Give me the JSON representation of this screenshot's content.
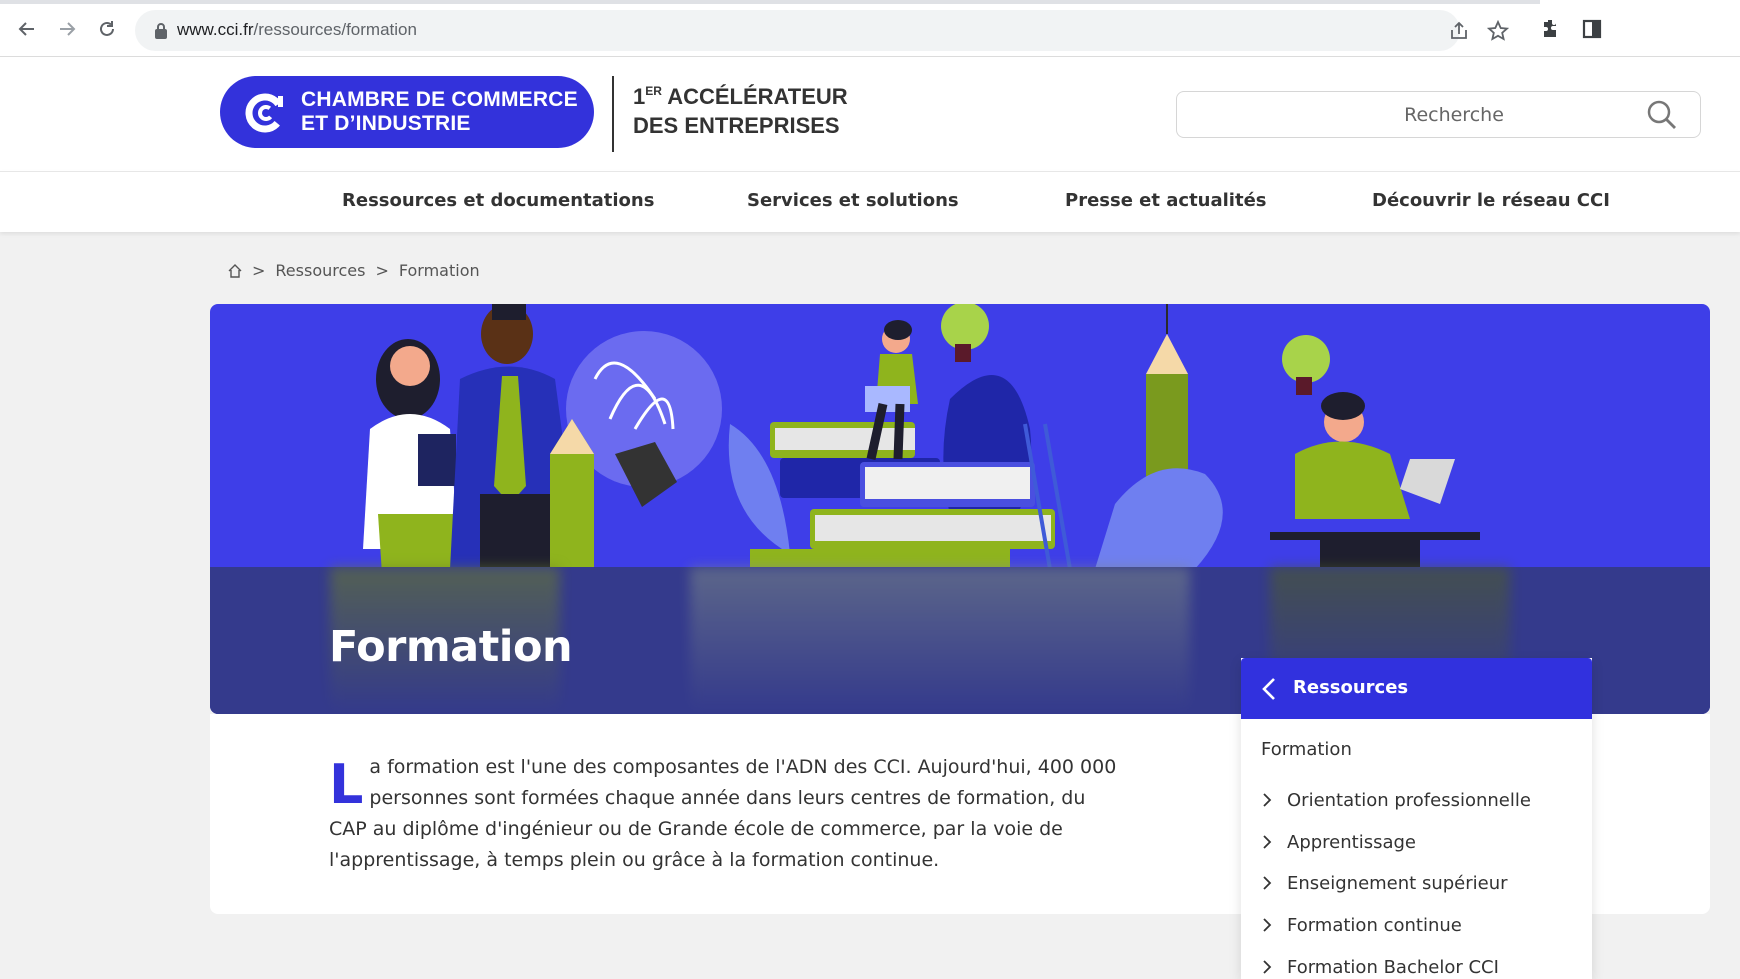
{
  "browser": {
    "url_host": "www.cci.fr",
    "url_path": "/ressources/formation"
  },
  "header": {
    "logo_line1": "CHAMBRE DE COMMERCE",
    "logo_line2": "ET D’INDUSTRIE",
    "tagline_num": "1",
    "tagline_sup": "ER",
    "tagline_line1": " ACCÉLÉRATEUR",
    "tagline_line2": "DES ENTREPRISES",
    "search_placeholder": "Recherche"
  },
  "nav": {
    "items": [
      {
        "label": "Ressources et documentations"
      },
      {
        "label": "Services et solutions"
      },
      {
        "label": "Presse et actualités"
      },
      {
        "label": "Découvrir le réseau CCI"
      }
    ]
  },
  "breadcrumb": {
    "sep": ">",
    "items": [
      "Ressources",
      "Formation"
    ]
  },
  "hero": {
    "title": "Formation"
  },
  "intro": {
    "dropcap": "L",
    "text": "a formation est l'une des composantes de l'ADN des CCI. Aujourd'hui, 400 000 personnes sont formées chaque année dans leurs centres de formation, du CAP au diplôme d'ingénieur ou de Grande école de commerce, par la voie de l'apprentissage, à temps plein ou grâce à la formation continue."
  },
  "submenu": {
    "back_label": "Ressources",
    "current": "Formation",
    "items": [
      {
        "label": "Orientation professionnelle"
      },
      {
        "label": "Apprentissage"
      },
      {
        "label": "Enseignement supérieur"
      },
      {
        "label": "Formation continue"
      },
      {
        "label": "Formation Bachelor CCI"
      }
    ]
  },
  "colors": {
    "brand_blue": "#3332db",
    "hero_blue": "#3e3ee8",
    "accent_green": "#8fb41d"
  }
}
